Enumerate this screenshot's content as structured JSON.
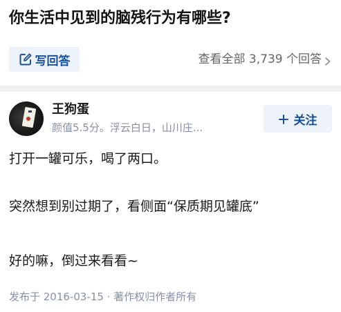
{
  "question": {
    "title": "你生活中见到的脑残行为有哪些?"
  },
  "actions": {
    "write_answer_label": "写回答",
    "view_all_label": "查看全部 3,739 个回答"
  },
  "author": {
    "name": "王狗蛋",
    "meta": "颜值5.5分。浮云白日，山川庄...",
    "follow_label": "关注"
  },
  "answer": {
    "lines": [
      "打开一罐可乐，喝了两口。",
      "突然想到别过期了，看侧面“保质期见罐底”",
      "好的嘛，倒过来看看~"
    ],
    "publish_info": "发布于 2016-03-15 · 著作权归作者所有"
  },
  "colors": {
    "accent": "#175199",
    "accent_bg": "#eef3fb",
    "meta_text": "#8590a6",
    "divider": "#f0f0f0"
  },
  "icons": {
    "write": "pencil-square-icon",
    "view_all": "chevron-right-icon",
    "follow": "plus-icon"
  }
}
